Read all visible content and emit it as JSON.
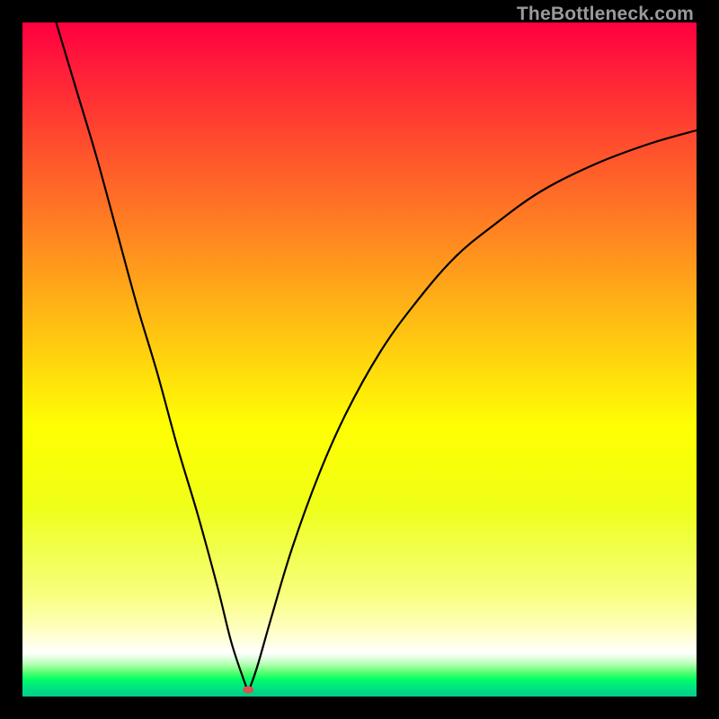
{
  "watermark": {
    "text": "TheBottleneck.com"
  },
  "chart_data": {
    "type": "line",
    "title": "",
    "xlabel": "",
    "ylabel": "",
    "xlim": [
      0,
      100
    ],
    "ylim": [
      0,
      100
    ],
    "grid": false,
    "legend": false,
    "marker": {
      "x": 33.5,
      "y": 1.0,
      "color": "#d9534f"
    },
    "background_gradient": {
      "orientation": "vertical",
      "stops": [
        {
          "pos": 0.0,
          "color": "#ff0040"
        },
        {
          "pos": 0.3,
          "color": "#ff7f22"
        },
        {
          "pos": 0.6,
          "color": "#ffff04"
        },
        {
          "pos": 0.9,
          "color": "#feffc0"
        },
        {
          "pos": 0.94,
          "color": "#ffffff"
        },
        {
          "pos": 1.0,
          "color": "#00cc8a"
        }
      ]
    },
    "series": [
      {
        "name": "bottleneck-curve",
        "x": [
          5,
          8,
          11,
          14,
          17,
          20,
          23,
          26,
          29,
          31,
          33,
          33.5,
          34,
          35,
          37,
          40,
          44,
          48,
          53,
          58,
          64,
          70,
          77,
          85,
          93,
          100
        ],
        "y": [
          100,
          90,
          80,
          69,
          58,
          48,
          37,
          27,
          16,
          8,
          2,
          1,
          2,
          5,
          12,
          22,
          33,
          42,
          51,
          58,
          65,
          70,
          75,
          79,
          82,
          84
        ]
      }
    ]
  }
}
